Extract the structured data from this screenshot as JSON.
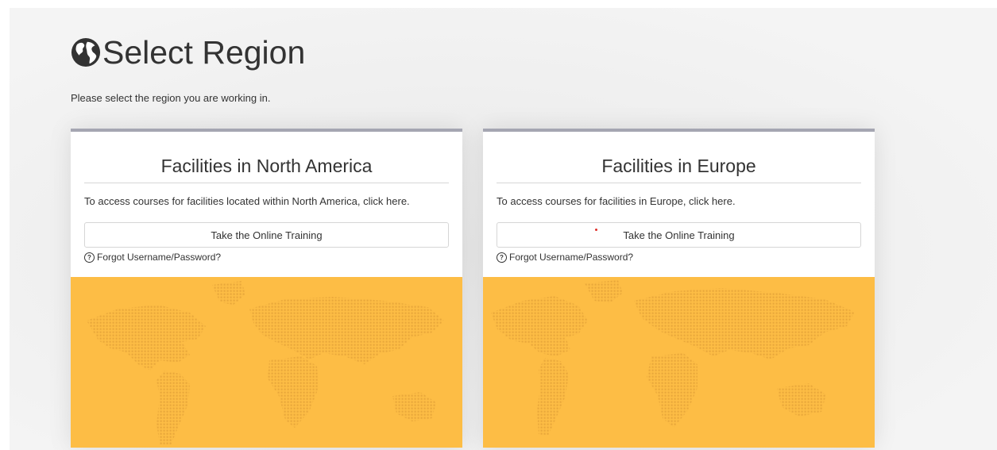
{
  "page": {
    "title": "Select Region",
    "subtitle": "Please select the region you are working in."
  },
  "regions": [
    {
      "title": "Facilities in North America",
      "description": "To access courses for facilities located within North America, click here.",
      "button_label": "Take the Online Training",
      "forgot_label": "Forgot Username/Password?"
    },
    {
      "title": "Facilities in Europe",
      "description": "To access courses for facilities in Europe, click here.",
      "button_label": "Take the Online Training",
      "forgot_label": "Forgot Username/Password?"
    }
  ],
  "colors": {
    "card_top_border": "#a5a6b2",
    "map_background": "#fdbd45",
    "map_dots": "#eaa93c"
  },
  "icons": {
    "title": "globe-icon",
    "forgot": "question-circle-icon",
    "map": "dotted-world-map"
  }
}
